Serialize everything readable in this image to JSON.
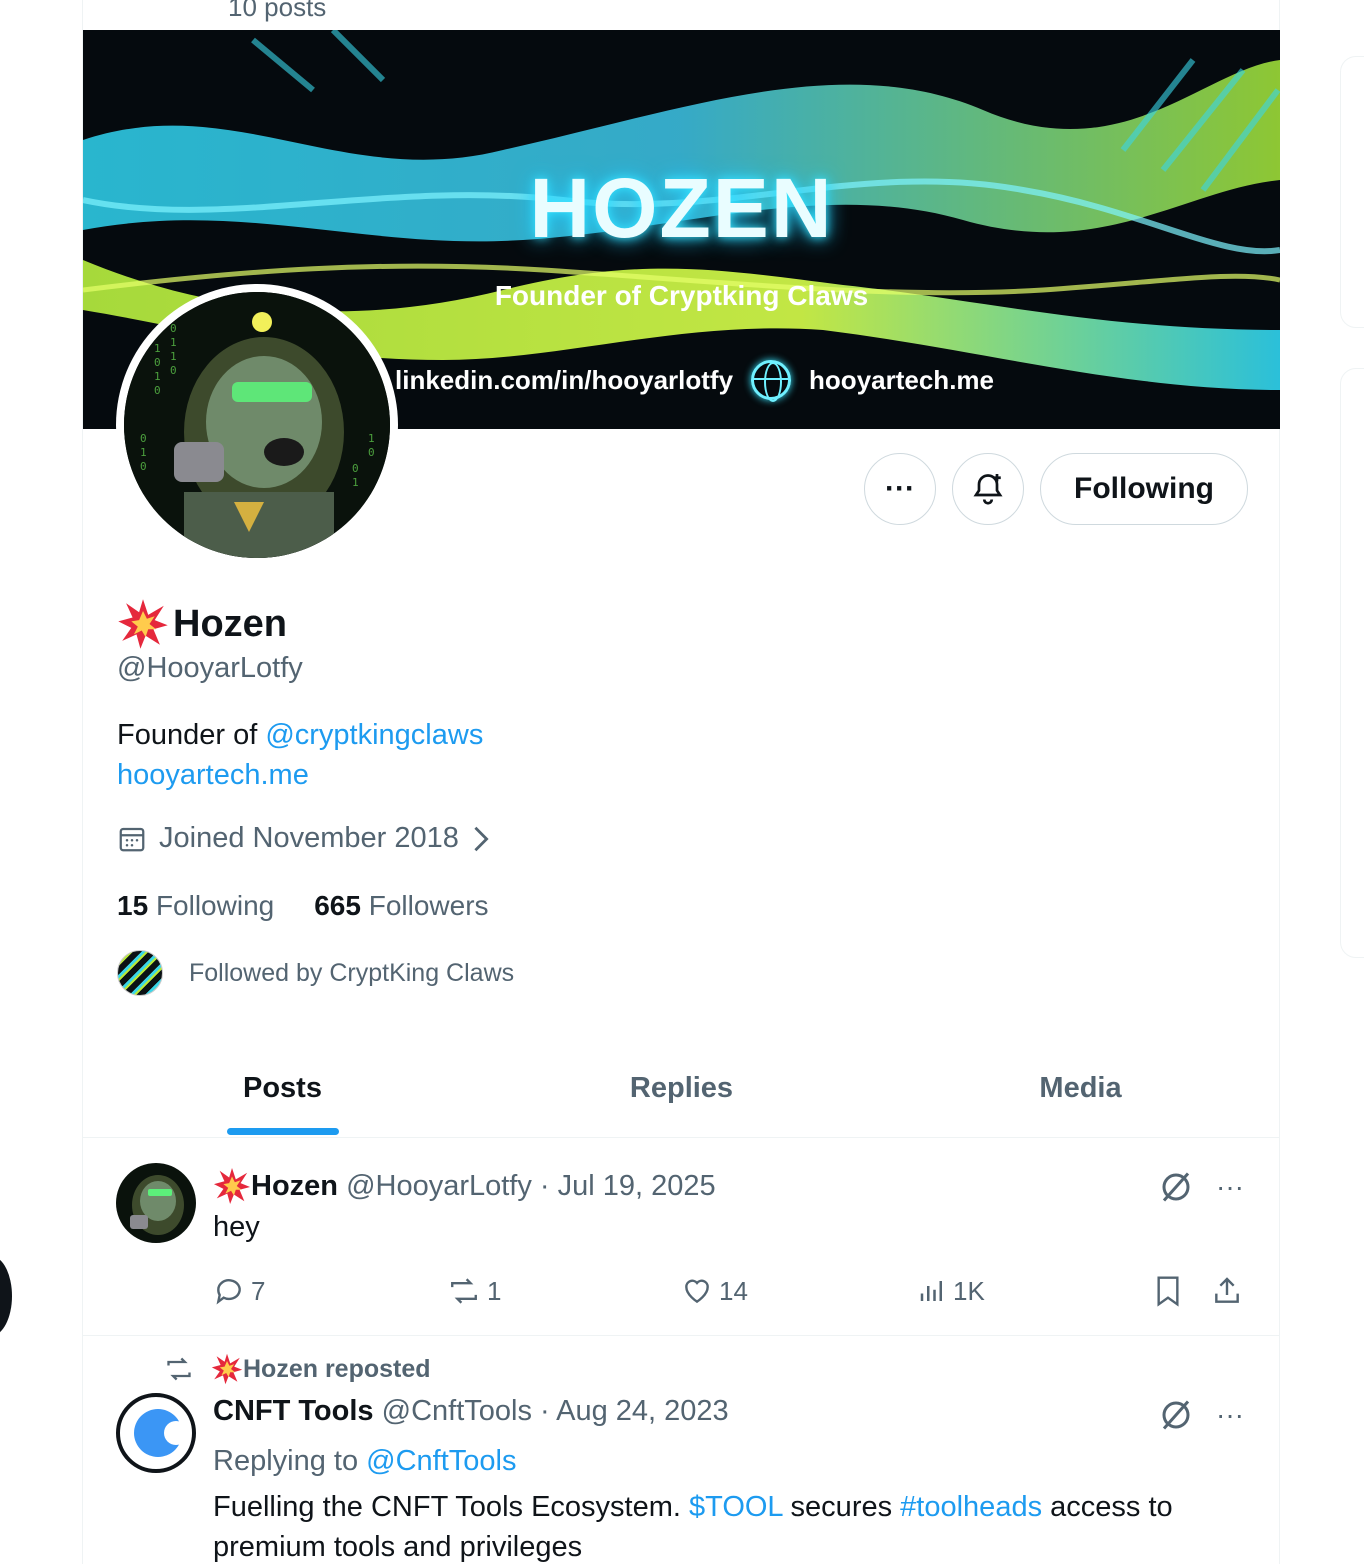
{
  "header": {
    "post_count": "10 posts"
  },
  "banner": {
    "title": "HOZEN",
    "subtitle": "Founder of Cryptking Claws",
    "link1": "linkedin.com/in/hooyarlotfy",
    "link2": "hooyartech.me"
  },
  "profile": {
    "display_name": "Hozen",
    "handle": "@HooyarLotfy",
    "bio_prefix": "Founder of ",
    "bio_mention": "@cryptkingclaws",
    "website": "hooyartech.me",
    "joined": "Joined November 2018",
    "following_count": "15",
    "following_label": "Following",
    "followers_count": "665",
    "followers_label": "Followers",
    "followed_by": "Followed by CryptKing Claws"
  },
  "actions": {
    "more": "···",
    "follow_button": "Following"
  },
  "tabs": [
    {
      "label": "Posts"
    },
    {
      "label": "Replies"
    },
    {
      "label": "Media"
    }
  ],
  "posts": [
    {
      "name": "Hozen",
      "handle": "@HooyarLotfy",
      "date": "· Jul 19, 2025",
      "text": "hey",
      "replies": "7",
      "reposts": "1",
      "likes": "14",
      "views": "1K"
    },
    {
      "repost_by": "Hozen reposted",
      "name": "CNFT Tools",
      "handle": "@CnftTools",
      "date": "· Aug 24, 2023",
      "reply_prefix": "Replying to ",
      "reply_to": "@CnftTools",
      "text_1": "Fuelling the CNFT Tools Ecosystem. ",
      "cashtag": "$TOOL",
      "text_2": " secures ",
      "hashtag": "#toolheads",
      "text_3": " access to premium tools and privileges"
    }
  ],
  "colors": {
    "accent": "#1d9bf0",
    "muted": "#536471",
    "text": "#0f1419"
  },
  "icons": [
    "ellipsis-icon",
    "bell-plus-icon",
    "calendar-icon",
    "chevron-right-icon",
    "reply-icon",
    "repost-icon",
    "like-icon",
    "views-icon",
    "bookmark-icon",
    "share-icon",
    "grok-icon",
    "explosion-emoji-icon",
    "globe-icon"
  ]
}
